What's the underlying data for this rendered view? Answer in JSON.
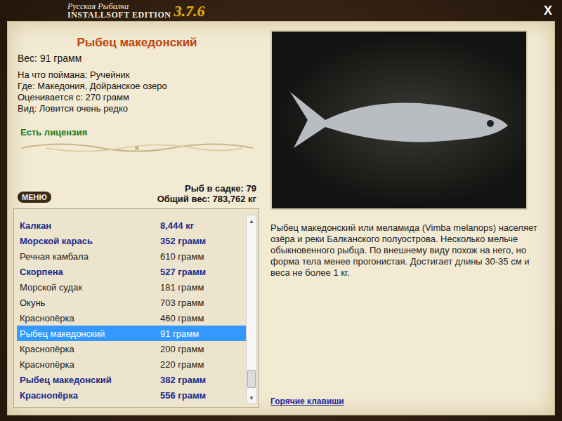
{
  "window": {
    "title_line1": "Русская Рыбалка",
    "title_line2": "INSTALLSOFT EDITION",
    "version": "3.7.6",
    "close": "X"
  },
  "fish": {
    "name": "Рыбец македонский",
    "weight": "Вес: 91 грамм",
    "details": [
      "На что поймана: Ручейник",
      "Где: Македония, Дойранское озеро",
      "Оценивается с: 270 грамм",
      "Вид: Ловится очень редко"
    ],
    "license": "Есть лицензия"
  },
  "summary": {
    "count": "Рыб в садке: 79",
    "total": "Общий вес: 783,762 кг"
  },
  "menu_button": "МЕНЮ",
  "catch_list": {
    "rows": [
      {
        "name": "Калкан",
        "weight": "8,444 кг",
        "bold": true,
        "selected": false
      },
      {
        "name": "Морской карась",
        "weight": "352 грамм",
        "bold": true,
        "selected": false
      },
      {
        "name": "Речная камбала",
        "weight": "610 грамм",
        "bold": false,
        "selected": false
      },
      {
        "name": "Скорпена",
        "weight": "527 грамм",
        "bold": true,
        "selected": false
      },
      {
        "name": "Морской судак",
        "weight": "181 грамм",
        "bold": false,
        "selected": false
      },
      {
        "name": "Окунь",
        "weight": "703 грамм",
        "bold": false,
        "selected": false
      },
      {
        "name": "Краснопёрка",
        "weight": "460 грамм",
        "bold": false,
        "selected": false
      },
      {
        "name": "Рыбец македонский",
        "weight": "91 грамм",
        "bold": false,
        "selected": true
      },
      {
        "name": "Краснопёрка",
        "weight": "200 грамм",
        "bold": false,
        "selected": false
      },
      {
        "name": "Краснопёрка",
        "weight": "220 грамм",
        "bold": false,
        "selected": false
      },
      {
        "name": "Рыбец македонский",
        "weight": "382 грамм",
        "bold": true,
        "selected": false
      },
      {
        "name": "Краснопёрка",
        "weight": "556 грамм",
        "bold": true,
        "selected": false
      }
    ],
    "scrollbar": {
      "up": "▲",
      "down": "▼",
      "level": 0.97
    }
  },
  "description": "Рыбец македонский или меламида (Vimba melanops) населяет озёра и реки Балканского полуострова. Несколько мельче обыкновенного рыбца. По внешнему виду похож на него, но форма тела менее прогонистая. Достигает длины 30-35 см и веса не более 1 кг.",
  "hotkeys_link": "Горячие клавиши"
}
